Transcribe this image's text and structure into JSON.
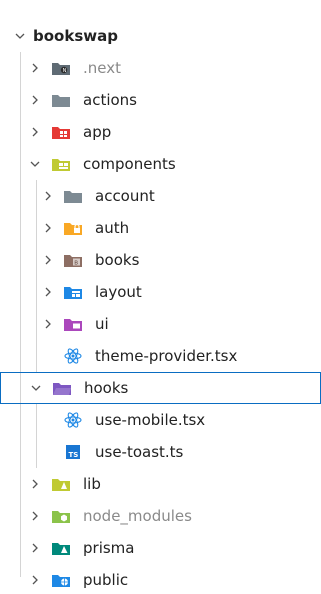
{
  "explorer": {
    "root": {
      "label": "bookswap",
      "expanded": true
    },
    "items": [
      {
        "label": ".next",
        "type": "folder",
        "icon": "next-folder-icon",
        "expanded": false,
        "dim": true
      },
      {
        "label": "actions",
        "type": "folder",
        "icon": "folder-icon",
        "expanded": false
      },
      {
        "label": "app",
        "type": "folder",
        "icon": "app-folder-icon",
        "expanded": false
      },
      {
        "label": "components",
        "type": "folder",
        "icon": "components-folder-icon",
        "expanded": true
      },
      {
        "label": "account",
        "type": "folder",
        "icon": "folder-icon",
        "expanded": false
      },
      {
        "label": "auth",
        "type": "folder",
        "icon": "auth-folder-icon",
        "expanded": false
      },
      {
        "label": "books",
        "type": "folder",
        "icon": "books-folder-icon",
        "expanded": false
      },
      {
        "label": "layout",
        "type": "folder",
        "icon": "layout-folder-icon",
        "expanded": false
      },
      {
        "label": "ui",
        "type": "folder",
        "icon": "ui-folder-icon",
        "expanded": false
      },
      {
        "label": "theme-provider.tsx",
        "type": "file",
        "icon": "react-icon"
      },
      {
        "label": "hooks",
        "type": "folder",
        "icon": "hooks-folder-icon",
        "expanded": true,
        "selected": true
      },
      {
        "label": "use-mobile.tsx",
        "type": "file",
        "icon": "react-icon"
      },
      {
        "label": "use-toast.ts",
        "type": "file",
        "icon": "typescript-icon"
      },
      {
        "label": "lib",
        "type": "folder",
        "icon": "lib-folder-icon",
        "expanded": false
      },
      {
        "label": "node_modules",
        "type": "folder",
        "icon": "node-modules-folder-icon",
        "expanded": false,
        "dim": true
      },
      {
        "label": "prisma",
        "type": "folder",
        "icon": "prisma-folder-icon",
        "expanded": false
      },
      {
        "label": "public",
        "type": "folder",
        "icon": "public-folder-icon",
        "expanded": false
      }
    ],
    "colors": {
      "selection_border": "#0a6dc2",
      "dim_text": "#8a8a8a",
      "text": "#222222"
    }
  }
}
